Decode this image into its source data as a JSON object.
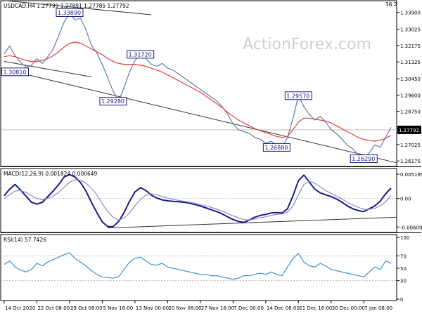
{
  "chart_data": {
    "type": "line",
    "panels": [
      {
        "id": "price",
        "title": "USDCAD,H4  1.27799 1.27891 1.27785 1.27792",
        "corner_label": "36.2",
        "watermark": "ActionForex.com",
        "ylim": [
          1.26,
          1.344
        ],
        "yticks": [
          "1.33900",
          "1.33025",
          "1.32175",
          "1.31325",
          "1.30450",
          "1.29600",
          "1.28750",
          "1.27875",
          "1.27025",
          "1.26175"
        ],
        "current_price": "1.27792",
        "series": [
          {
            "role": "price",
            "color": "#5a7ea8",
            "values": [
              1.3175,
              1.3215,
              1.3165,
              1.313,
              1.3105,
              1.3115,
              1.315,
              1.3125,
              1.316,
              1.32,
              1.327,
              1.334,
              1.3385,
              1.335,
              1.336,
              1.33,
              1.322,
              1.318,
              1.312,
              1.305,
              1.298,
              1.2928,
              1.3,
              1.308,
              1.314,
              1.3172,
              1.315,
              1.312,
              1.311,
              1.3125,
              1.31,
              1.309,
              1.307,
              1.305,
              1.303,
              1.301,
              1.299,
              1.297,
              1.295,
              1.293,
              1.29,
              1.286,
              1.281,
              1.278,
              1.277,
              1.276,
              1.274,
              1.273,
              1.271,
              1.272,
              1.27,
              1.2688,
              1.274,
              1.284,
              1.2957,
              1.29,
              1.286,
              1.283,
              1.285,
              1.282,
              1.278,
              1.276,
              1.273,
              1.27,
              1.268,
              1.265,
              1.2629,
              1.266,
              1.27,
              1.269,
              1.274,
              1.2792
            ]
          },
          {
            "role": "moving-average",
            "color": "#e0403a",
            "values": [
              1.316,
              1.3165,
              1.316,
              1.315,
              1.314,
              1.3135,
              1.3135,
              1.314,
              1.315,
              1.3165,
              1.3185,
              1.321,
              1.323,
              1.3235,
              1.323,
              1.3215,
              1.32,
              1.3185,
              1.317,
              1.315,
              1.3135,
              1.3125,
              1.312,
              1.312,
              1.312,
              1.3115,
              1.311,
              1.31,
              1.309,
              1.308,
              1.3065,
              1.305,
              1.3035,
              1.302,
              1.3005,
              1.299,
              1.2975,
              1.2955,
              1.2935,
              1.2915,
              1.2895,
              1.287,
              1.285,
              1.283,
              1.2815,
              1.28,
              1.2785,
              1.2775,
              1.2765,
              1.2755,
              1.2745,
              1.274,
              1.2745,
              1.278,
              1.282,
              1.284,
              1.284,
              1.2835,
              1.283,
              1.2825,
              1.2815,
              1.28,
              1.2785,
              1.277,
              1.2755,
              1.274,
              1.273,
              1.2725,
              1.272,
              1.2725,
              1.2735,
              1.275
            ]
          }
        ],
        "trendlines": [
          {
            "from": [
              0,
              1.3135
            ],
            "to": [
              16,
              1.3055
            ]
          },
          {
            "from": [
              0,
              1.3452
            ],
            "to": [
              27,
              1.3378
            ]
          },
          {
            "from": [
              0,
              1.3095
            ],
            "to": [
              72,
              1.2608
            ]
          }
        ],
        "annotations": [
          {
            "text": "1.33890",
            "i": 12,
            "v": 1.3389
          },
          {
            "text": "1.30810",
            "i": 2,
            "v": 1.3081
          },
          {
            "text": "1.31720",
            "i": 25,
            "v": 1.3172
          },
          {
            "text": "1.29280",
            "i": 20,
            "v": 1.2928
          },
          {
            "text": "1.29570",
            "i": 54,
            "v": 1.2957
          },
          {
            "text": "1.26880",
            "i": 50,
            "v": 1.2688
          },
          {
            "text": "1.26290",
            "i": 66,
            "v": 1.2629
          }
        ]
      },
      {
        "id": "macd",
        "title": "MACD(12,26,9) 0.001824 0.000649",
        "ylim": [
          -0.0068,
          0.0058
        ],
        "yticks": [
          "0.005195",
          "0.00",
          "-0.006093"
        ],
        "current_value": "0.00",
        "series": [
          {
            "role": "macd",
            "color": "#1a1a8c",
            "values": [
              0.0006,
              0.002,
              0.003,
              0.0018,
              0.0005,
              -0.0008,
              -0.0012,
              -0.0008,
              0.0004,
              0.0016,
              0.003,
              0.0046,
              0.0051,
              0.0046,
              0.0034,
              0.0016,
              -0.0008,
              -0.003,
              -0.005,
              -0.006,
              -0.006,
              -0.0049,
              -0.003,
              -0.0006,
              0.0014,
              0.0023,
              0.0017,
              0.0007,
              0.0001,
              -0.0003,
              -0.0005,
              -0.0006,
              -0.0007,
              -0.0008,
              -0.001,
              -0.0013,
              -0.0016,
              -0.002,
              -0.0024,
              -0.0028,
              -0.0033,
              -0.0039,
              -0.0045,
              -0.0049,
              -0.0051,
              -0.0046,
              -0.004,
              -0.0036,
              -0.0034,
              -0.0031,
              -0.003,
              -0.0031,
              -0.0022,
              0.0006,
              0.0038,
              0.005,
              0.0035,
              0.002,
              0.0012,
              0.0008,
              0.0004,
              -0.0001,
              -0.0008,
              -0.0016,
              -0.0022,
              -0.0026,
              -0.0028,
              -0.0022,
              -0.0016,
              -0.0006,
              0.001,
              0.0022
            ]
          },
          {
            "role": "signal",
            "color": "#8c8cc8",
            "values": [
              0.0,
              0.0008,
              0.0016,
              0.0017,
              0.0013,
              0.0006,
              0.0,
              -0.0002,
              0.0,
              0.0005,
              0.0013,
              0.0024,
              0.0035,
              0.004,
              0.0039,
              0.0033,
              0.0022,
              0.0008,
              -0.0011,
              -0.0028,
              -0.004,
              -0.0046,
              -0.0042,
              -0.0031,
              -0.0016,
              -0.0002,
              0.0007,
              0.001,
              0.0008,
              0.0004,
              0.0001,
              -0.0002,
              -0.0004,
              -0.0006,
              -0.0008,
              -0.001,
              -0.0013,
              -0.0016,
              -0.0019,
              -0.0023,
              -0.0027,
              -0.0032,
              -0.0037,
              -0.0041,
              -0.0045,
              -0.0046,
              -0.0044,
              -0.0041,
              -0.0039,
              -0.0036,
              -0.0034,
              -0.0033,
              -0.0029,
              -0.0016,
              0.0008,
              0.003,
              0.0037,
              0.0033,
              0.0025,
              0.0017,
              0.0011,
              0.0005,
              -0.0001,
              -0.0008,
              -0.0014,
              -0.0019,
              -0.0023,
              -0.0023,
              -0.0021,
              -0.0016,
              -0.0007,
              0.0006
            ]
          }
        ],
        "trendlines": [
          {
            "from": [
              19,
              -0.0063
            ],
            "to": [
              72,
              -0.004
            ]
          }
        ]
      },
      {
        "id": "rsi",
        "title": "RSI(14) 57.7426",
        "ylim": [
          0,
          100
        ],
        "yticks": [
          "100",
          "70",
          "50",
          "30",
          "0"
        ],
        "series": [
          {
            "role": "rsi",
            "color": "#3a8fd8",
            "values": [
              56,
              62,
              52,
              47,
              44,
              48,
              58,
              54,
              60,
              64,
              68,
              72,
              75,
              66,
              60,
              54,
              46,
              40,
              36,
              35,
              34,
              36,
              48,
              60,
              66,
              68,
              62,
              56,
              55,
              58,
              52,
              50,
              48,
              46,
              44,
              42,
              40,
              40,
              38,
              38,
              36,
              34,
              32,
              34,
              38,
              38,
              40,
              42,
              40,
              44,
              40,
              38,
              52,
              66,
              74,
              60,
              54,
              52,
              58,
              54,
              48,
              46,
              44,
              42,
              40,
              38,
              36,
              44,
              52,
              48,
              62,
              57.7
            ]
          }
        ]
      }
    ],
    "xtick_labels": [
      {
        "label": "14 Oct 2020",
        "i": 0
      },
      {
        "label": "22 Oct 08:00",
        "i": 6
      },
      {
        "label": "29 Oct 08:00",
        "i": 12
      },
      {
        "label": "5 Nov 16:00",
        "i": 18
      },
      {
        "label": "13 Nov 00:00",
        "i": 24
      },
      {
        "label": "20 Nov 08:00",
        "i": 30
      },
      {
        "label": "27 Nov 16:00",
        "i": 36
      },
      {
        "label": "7 Dec 00:00",
        "i": 42
      },
      {
        "label": "14 Dec 08:00",
        "i": 48
      },
      {
        "label": "21 Dec 16:00",
        "i": 54
      },
      {
        "label": "30 Dec 00:00",
        "i": 60
      },
      {
        "label": "7 Jan 08:00",
        "i": 66
      }
    ]
  }
}
